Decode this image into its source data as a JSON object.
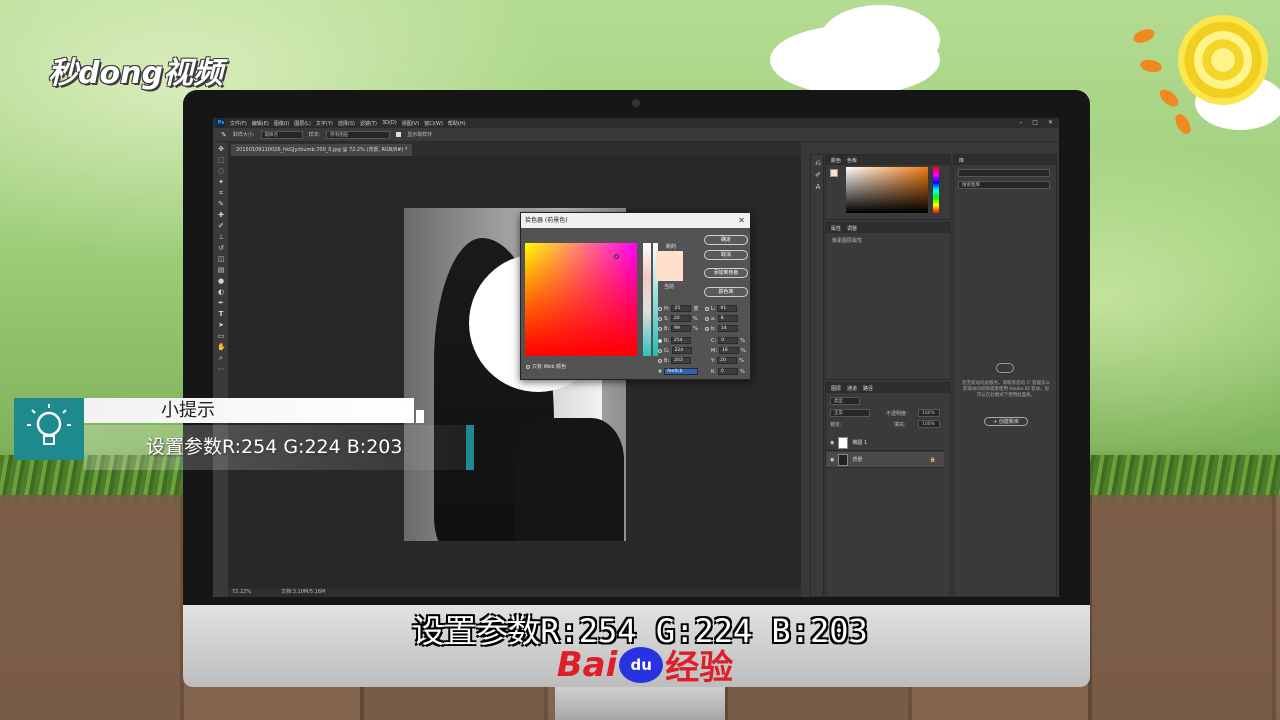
{
  "watermark": {
    "logo": "秒dong视频"
  },
  "ps": {
    "menu": [
      "文件(F)",
      "编辑(E)",
      "图像(I)",
      "图层(L)",
      "文字(Y)",
      "选择(S)",
      "滤镜(T)",
      "3D(D)",
      "视图(V)",
      "窗口(W)",
      "帮助(H)"
    ],
    "app_icon": "Ps",
    "options": {
      "sample_size_label": "取样大小:",
      "sample_size_value": "取样点",
      "sample_label": "样本:",
      "sample_value": "所有图层",
      "ring_label": "显示取样环"
    },
    "doc_tab": "20150109110026_hkGJy.thumb.700_0.jpg @ 72.2% (背景, RGB/8#) *",
    "status": {
      "zoom": "72.22%",
      "doc": "文档:3.10M/5.16M"
    },
    "panels": {
      "color_tabs": [
        "颜色",
        "色板"
      ],
      "props_tabs": [
        "属性",
        "调整"
      ],
      "props_subtitle": "像素图层属性",
      "layers_tabs": [
        "图层",
        "通道",
        "路径"
      ],
      "layer_kind": "类型",
      "blend": "正常",
      "opacity_label": "不透明度:",
      "opacity_value": "100%",
      "lock_label": "锁定:",
      "fill_label": "填充:",
      "fill_value": "100%",
      "layers": [
        {
          "name": "椭圆 1"
        },
        {
          "name": "背景"
        }
      ],
      "library_tab": "库",
      "library_search": "搜索图库",
      "library_msg": "您无权访问此服务。请联系您的 IT 管理员以获取访问权限或者使用 Adobe ID 登录。您可以在此模式下使用此面板。",
      "create_library": "+ 创建新库"
    },
    "picker": {
      "title": "拾色器 (前景色)",
      "new_label": "新的",
      "current_label": "当前",
      "buttons": [
        "确定",
        "取消",
        "添加到色板",
        "颜色库"
      ],
      "fields": {
        "H": "25",
        "H_unit": "度",
        "S": "20",
        "S_unit": "%",
        "B": "99",
        "B_unit": "%",
        "R": "254",
        "G": "224",
        "Bv": "203",
        "L": "91",
        "a": "8",
        "b": "14",
        "C": "0",
        "M": "18",
        "Y": "20",
        "K": "0",
        "pct": "%"
      },
      "hex_label": "#",
      "hex": "fee0cb",
      "web_only": "只有 Web 颜色"
    }
  },
  "tip": {
    "title": "小提示",
    "body": "设置参数R:254 G:224 B:203"
  },
  "caption": "设置参数R:254 G:224 B:203",
  "brand": {
    "left": "Bai",
    "paw": "du",
    "right": "经验"
  },
  "colors": {
    "accent": "#1f8a8e",
    "swatch": "#fee0cb",
    "brand_red": "#de1e28",
    "brand_blue": "#2932e1"
  }
}
